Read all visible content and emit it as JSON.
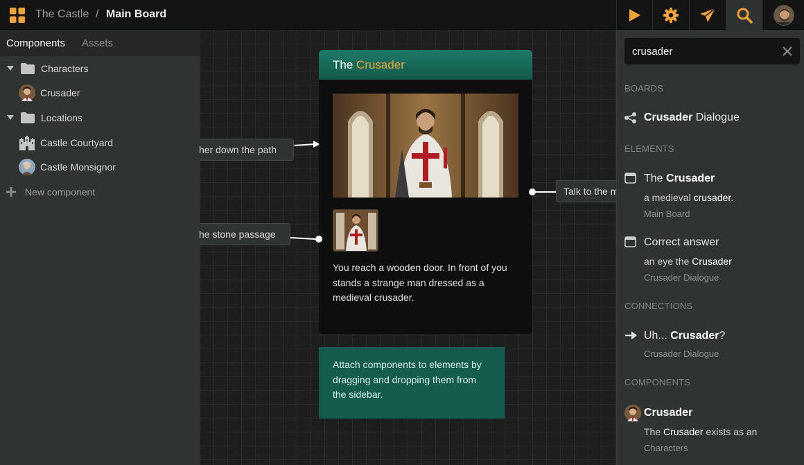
{
  "topbar": {
    "project": "The Castle",
    "separator": "/",
    "board": "Main Board",
    "accent": "#f0a437",
    "buttons": [
      {
        "name": "play-icon"
      },
      {
        "name": "gear-icon"
      },
      {
        "name": "send-icon"
      },
      {
        "name": "search-icon",
        "active": true
      },
      {
        "name": "user-avatar"
      }
    ]
  },
  "sidebar": {
    "tabs": [
      "Components",
      "Assets"
    ],
    "items": [
      {
        "label": "Characters",
        "type": "folder",
        "icon": "folder-icon"
      },
      {
        "label": "Crusader",
        "type": "component",
        "icon": "crusader-avatar"
      },
      {
        "label": "Locations",
        "type": "folder",
        "icon": "folder-icon"
      },
      {
        "label": "Castle Courtyard",
        "type": "component",
        "icon": "castle-icon"
      },
      {
        "label": "Castle Monsignor",
        "type": "component",
        "icon": "monsignor-avatar"
      },
      {
        "label": "New component",
        "type": "action",
        "icon": "plus-icon"
      }
    ]
  },
  "canvas": {
    "connections": [
      {
        "label": "her down the path"
      },
      {
        "label": "he stone passage"
      },
      {
        "label": "Talk to the m"
      }
    ],
    "card": {
      "title_prefix": "The",
      "title_highlight": "Crusader",
      "text": "You reach a wooden door. In front of you stands a strange man dressed as a medieval crusader."
    },
    "note": {
      "text": "Attach components to elements by dragging and dropping them from the sidebar."
    }
  },
  "search": {
    "query": "crusader",
    "sections": {
      "boards": "BOARDS",
      "elements": "ELEMENTS",
      "connections": "CONNECTIONS",
      "components": "COMPONENTS"
    },
    "boards": [
      {
        "title_hl": "Crusader",
        "title_rest": " Dialogue",
        "icon": "board-icon"
      }
    ],
    "elements": [
      {
        "title_pre": "The ",
        "title_hl": "Crusader",
        "snippet_pre": "a medieval ",
        "snippet_hl": "crusader",
        "snippet_post": ".",
        "board": "Main Board",
        "icon": "element-icon"
      },
      {
        "title_pre": "Correct answer",
        "title_hl": "",
        "snippet_pre": "an eye the ",
        "snippet_hl": "Crusader",
        "snippet_post": "",
        "board": "Crusader Dialogue",
        "icon": "element-icon"
      }
    ],
    "connections": [
      {
        "title_pre": "Uh... ",
        "title_hl": "Crusader",
        "title_post": "?",
        "board": "Crusader Dialogue",
        "icon": "arrow-right-icon"
      }
    ],
    "components": [
      {
        "title_hl": "Crusader",
        "snippet_pre": "The ",
        "snippet_hl": "Crusader",
        "snippet_post": " exists as an",
        "folder": "Characters",
        "icon": "crusader-avatar"
      }
    ]
  }
}
